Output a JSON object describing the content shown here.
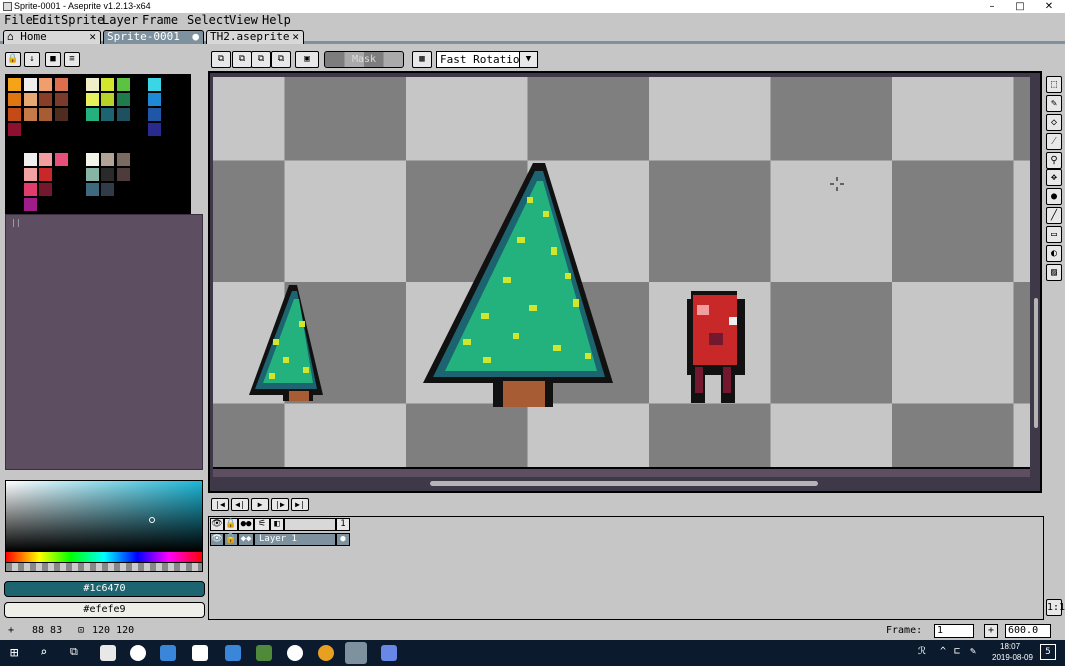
{
  "window": {
    "title": "Sprite-0001 - Aseprite v1.2.13-x64",
    "minimize": "–",
    "maximize": "□",
    "close": "✕"
  },
  "menu": [
    "File",
    "Edit",
    "Sprite",
    "Layer",
    "Frame",
    "Select",
    "View",
    "Help"
  ],
  "tabs": [
    {
      "label": "Home",
      "icon": "home-icon",
      "close": "✕"
    },
    {
      "label": "Sprite-0001",
      "modified": "●"
    },
    {
      "label": "TH2.aseprite",
      "close": "✕"
    }
  ],
  "toolbar": {
    "mask_label": "Mask",
    "rotation_select": "Fast Rotation",
    "dropdown": "▼"
  },
  "palette": {
    "colors": [
      [
        "#f4a416",
        "#eeeeee",
        "#f29e6c",
        "#dd6e4e",
        null,
        "#efefc8",
        "#d2e62d",
        "#5cc242",
        null,
        "#3bd6e6"
      ],
      [
        "#e0760f",
        "#e8a874",
        "#8a3e2a",
        "#7a3b2a",
        null,
        "#e6f05c",
        "#b8d22a",
        "#1f7a4c",
        null,
        "#1e8ad6"
      ],
      [
        "#c44a18",
        "#c67a4a",
        "#a85c34",
        "#4e2c20",
        null,
        "#23b27e",
        "#1c6470",
        "#1f5060",
        null,
        "#1f56a6"
      ],
      [
        "#8e1030",
        null,
        null,
        null,
        null,
        null,
        null,
        null,
        null,
        "#2a2a8e"
      ],
      [
        null,
        null,
        null,
        null,
        null,
        null,
        null,
        null,
        null,
        null
      ],
      [
        null,
        "#efefef",
        "#f29e9e",
        "#e6507a",
        null,
        "#f4f4e8",
        "#b2a494",
        "#7a6a60",
        null,
        null
      ],
      [
        null,
        "#f2a2a2",
        "#c82828",
        null,
        null,
        "#88b4a8",
        "#2a2a2a",
        "#4e3c3c",
        null,
        null
      ],
      [
        null,
        "#e03c6e",
        "#741830",
        null,
        null,
        "#3e6a80",
        "#303a48",
        null,
        null,
        null
      ],
      [
        null,
        "#a01c8a",
        null,
        null,
        null,
        null,
        null,
        null,
        null,
        null
      ]
    ]
  },
  "colors": {
    "foreground": "#1c6470",
    "background": "#efefe9",
    "foreground_label": "#1c6470",
    "background_label": "#efefe9"
  },
  "layers": {
    "header_frame": "1",
    "layer_name": "Layer 1"
  },
  "status": {
    "cursor_pos": "88 83",
    "sprite_size": "120 120",
    "frame_label": "Frame:",
    "frame_value": "1",
    "zoom": "600.0",
    "add": "+",
    "zoom_reset": "1:1"
  },
  "taskbar": {
    "time": "18:07",
    "date": "2019-08-09",
    "notif": "5"
  }
}
